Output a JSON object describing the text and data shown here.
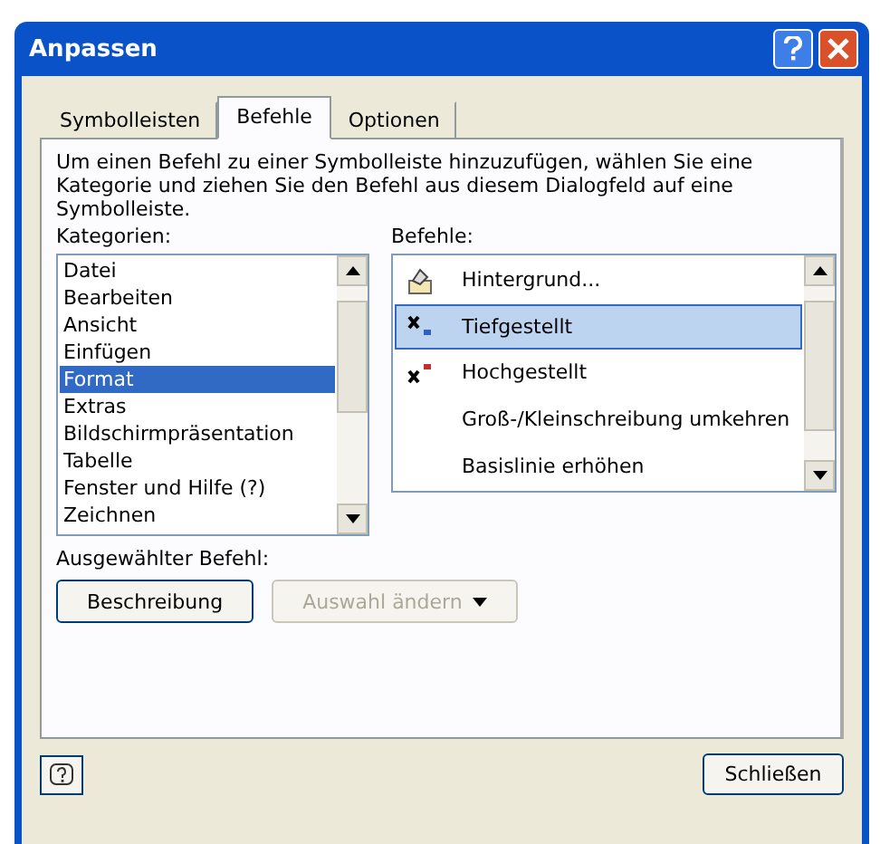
{
  "window": {
    "title": "Anpassen"
  },
  "tabs": [
    {
      "label": "Symbolleisten",
      "selected": false
    },
    {
      "label": "Befehle",
      "selected": true
    },
    {
      "label": "Optionen",
      "selected": false
    }
  ],
  "instructions": "Um einen Befehl zu einer Symbolleiste hinzuzufügen, wählen Sie eine Kategorie und ziehen Sie den Befehl aus diesem Dialogfeld auf eine Symbolleiste.",
  "categories": {
    "label": "Kategorien:",
    "items": [
      {
        "label": "Datei",
        "selected": false
      },
      {
        "label": "Bearbeiten",
        "selected": false
      },
      {
        "label": "Ansicht",
        "selected": false
      },
      {
        "label": "Einfügen",
        "selected": false
      },
      {
        "label": "Format",
        "selected": true
      },
      {
        "label": "Extras",
        "selected": false
      },
      {
        "label": "Bildschirmpräsentation",
        "selected": false
      },
      {
        "label": "Tabelle",
        "selected": false
      },
      {
        "label": "Fenster und Hilfe (?)",
        "selected": false
      },
      {
        "label": "Zeichnen",
        "selected": false
      }
    ]
  },
  "commands": {
    "label": "Befehle:",
    "items": [
      {
        "label": "Hintergrund...",
        "kind": "background",
        "selected": false
      },
      {
        "label": "Tiefgestellt",
        "kind": "subscript",
        "selected": true
      },
      {
        "label": "Hochgestellt",
        "kind": "superscript",
        "selected": false
      },
      {
        "label": "Groß-/Kleinschreibung umkehren",
        "kind": "plain",
        "selected": false
      },
      {
        "label": "Basislinie erhöhen",
        "kind": "plain",
        "selected": false
      }
    ]
  },
  "selected_command": {
    "label": "Ausgewählter Befehl:",
    "buttons": [
      {
        "label": "Beschreibung",
        "disabled": false
      },
      {
        "label": "Auswahl ändern",
        "disabled": true,
        "dropdown": true
      }
    ]
  },
  "footer": {
    "close_button": "Schließen"
  }
}
